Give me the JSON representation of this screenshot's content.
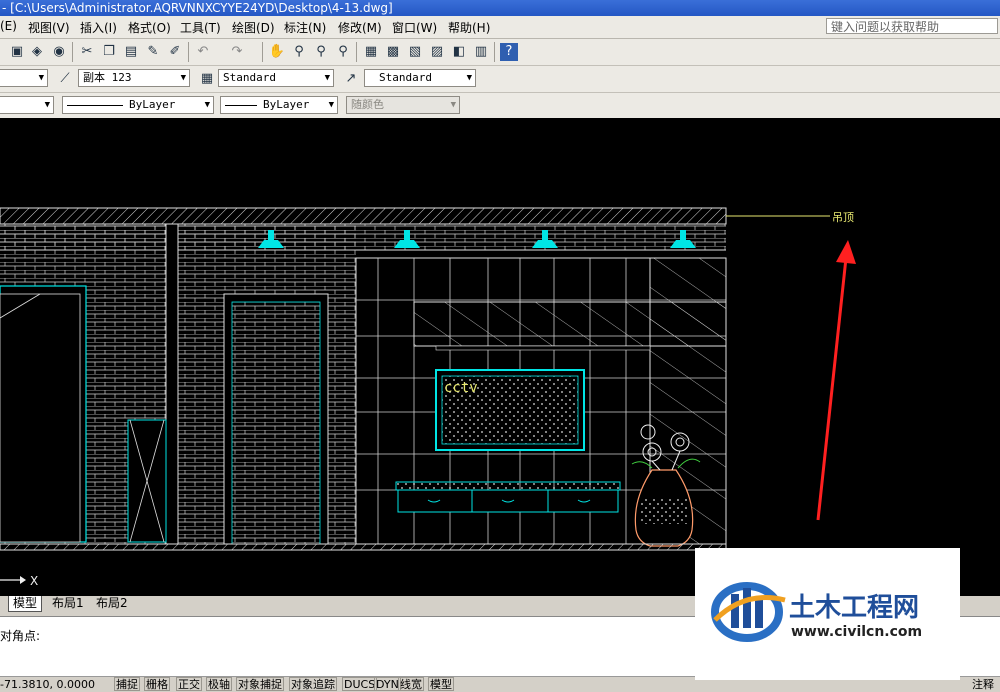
{
  "window": {
    "title": "- [C:\\Users\\Administrator.AQRVNNXCYYE24YD\\Desktop\\4-13.dwg]"
  },
  "menu": {
    "items": [
      "(E)",
      "视图(V)",
      "插入(I)",
      "格式(O)",
      "工具(T)",
      "绘图(D)",
      "标注(N)",
      "修改(M)",
      "窗口(W)",
      "帮助(H)"
    ],
    "help_placeholder": "键入问题以获取帮助"
  },
  "toolbar2": {
    "dimstyle": "副本 123",
    "textstyle": "Standard",
    "tablestyle": "Standard"
  },
  "toolbar3": {
    "linetype": "ByLayer",
    "lineweight": "ByLayer",
    "plotstyle": "随颜色"
  },
  "drawing": {
    "tv_label": "cctv",
    "annotation": "吊顶",
    "ucs_axis": "X"
  },
  "tabs": [
    "模型",
    "布局1",
    "布局2"
  ],
  "command": {
    "prompt": "对角点:"
  },
  "status": {
    "coords": "-71.3810, 0.0000",
    "buttons": [
      "捕捉",
      "栅格",
      "正交",
      "极轴",
      "对象捕捉",
      "对象追踪",
      "DUCS",
      "DYN",
      "线宽",
      "模型"
    ],
    "right_label": "注释"
  },
  "watermark": {
    "name": "土木工程网",
    "url": "www.civilcn.com"
  },
  "colors": {
    "drawing_bg": "#000000",
    "cyan": "#00e5e5",
    "white_line": "#e8e8e8",
    "arrow": "#ff2020",
    "yellow_text": "#e8e870"
  }
}
